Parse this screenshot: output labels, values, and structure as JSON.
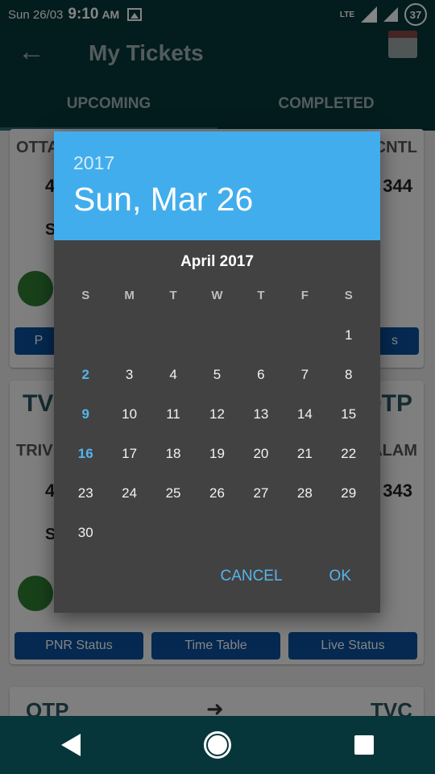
{
  "status_bar": {
    "date": "Sun 26/03",
    "time": "9:10",
    "ampm": "AM",
    "network": "LTE",
    "battery": "37"
  },
  "toolbar": {
    "title": "My Tickets"
  },
  "tabs": [
    {
      "label": "UPCOMING"
    },
    {
      "label": "COMPLETED"
    }
  ],
  "background": {
    "card1": {
      "from": "OTTA",
      "to": "CNTL",
      "num_left": "4",
      "num_right": "344",
      "bed_label": "S",
      "btn_left": "P",
      "btn_right": "s"
    },
    "card2": {
      "from_code": "TV",
      "to_code": "OTP",
      "from_name": "TRIV",
      "to_name": "ALAM",
      "num_left": "4",
      "num_right": "343",
      "bed_label": "S",
      "buttons": [
        "PNR Status",
        "Time Table",
        "Live Status"
      ]
    },
    "card3": {
      "from_code": "OTP",
      "to_code": "TVC"
    }
  },
  "date_picker": {
    "year": "2017",
    "selected_date": "Sun, Mar 26",
    "month_label": "April 2017",
    "weekdays": [
      "S",
      "M",
      "T",
      "W",
      "T",
      "F",
      "S"
    ],
    "weeks": [
      [
        "",
        "",
        "",
        "",
        "",
        "",
        "1"
      ],
      [
        "2",
        "3",
        "4",
        "5",
        "6",
        "7",
        "8"
      ],
      [
        "9",
        "10",
        "11",
        "12",
        "13",
        "14",
        "15"
      ],
      [
        "16",
        "17",
        "18",
        "19",
        "20",
        "21",
        "22"
      ],
      [
        "23",
        "24",
        "25",
        "26",
        "27",
        "28",
        "29"
      ],
      [
        "30",
        "",
        "",
        "",
        "",
        "",
        ""
      ]
    ],
    "highlighted_days": [
      "2",
      "9",
      "16"
    ],
    "cancel_label": "CANCEL",
    "ok_label": "OK"
  },
  "colors": {
    "header_blue": "#42adec",
    "accent": "#56b4ea",
    "dialog_bg": "#424242",
    "app_bar": "#06363a"
  }
}
